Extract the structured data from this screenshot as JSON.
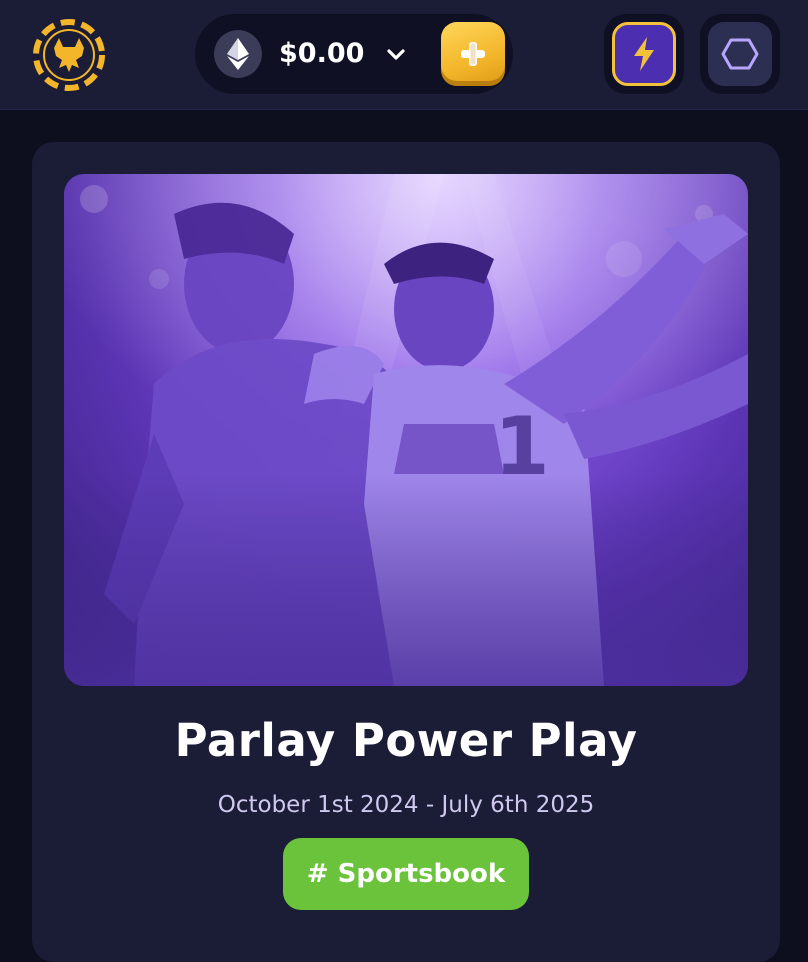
{
  "header": {
    "logo_icon": "fox-chip-logo-icon",
    "wallet": {
      "currency_icon": "ethereum-icon",
      "balance": "$0.00",
      "dropdown_icon": "chevron-down-icon",
      "add_funds_icon": "plus-icon"
    },
    "rewards_icon": "lightning-bolt-icon",
    "menu_icon": "hexagon-icon"
  },
  "promotion": {
    "image_description": "sports-players-hero-image",
    "title": "Parlay Power Play",
    "dates": "October 1st 2024 - July 6th 2025",
    "tag_label": "# Sportsbook"
  },
  "colors": {
    "background": "#0d0f1f",
    "panel": "#1b1c36",
    "accent_gold": "#f3b52a",
    "accent_purple": "#4b2fb0",
    "tag_green": "#6bc23b"
  }
}
